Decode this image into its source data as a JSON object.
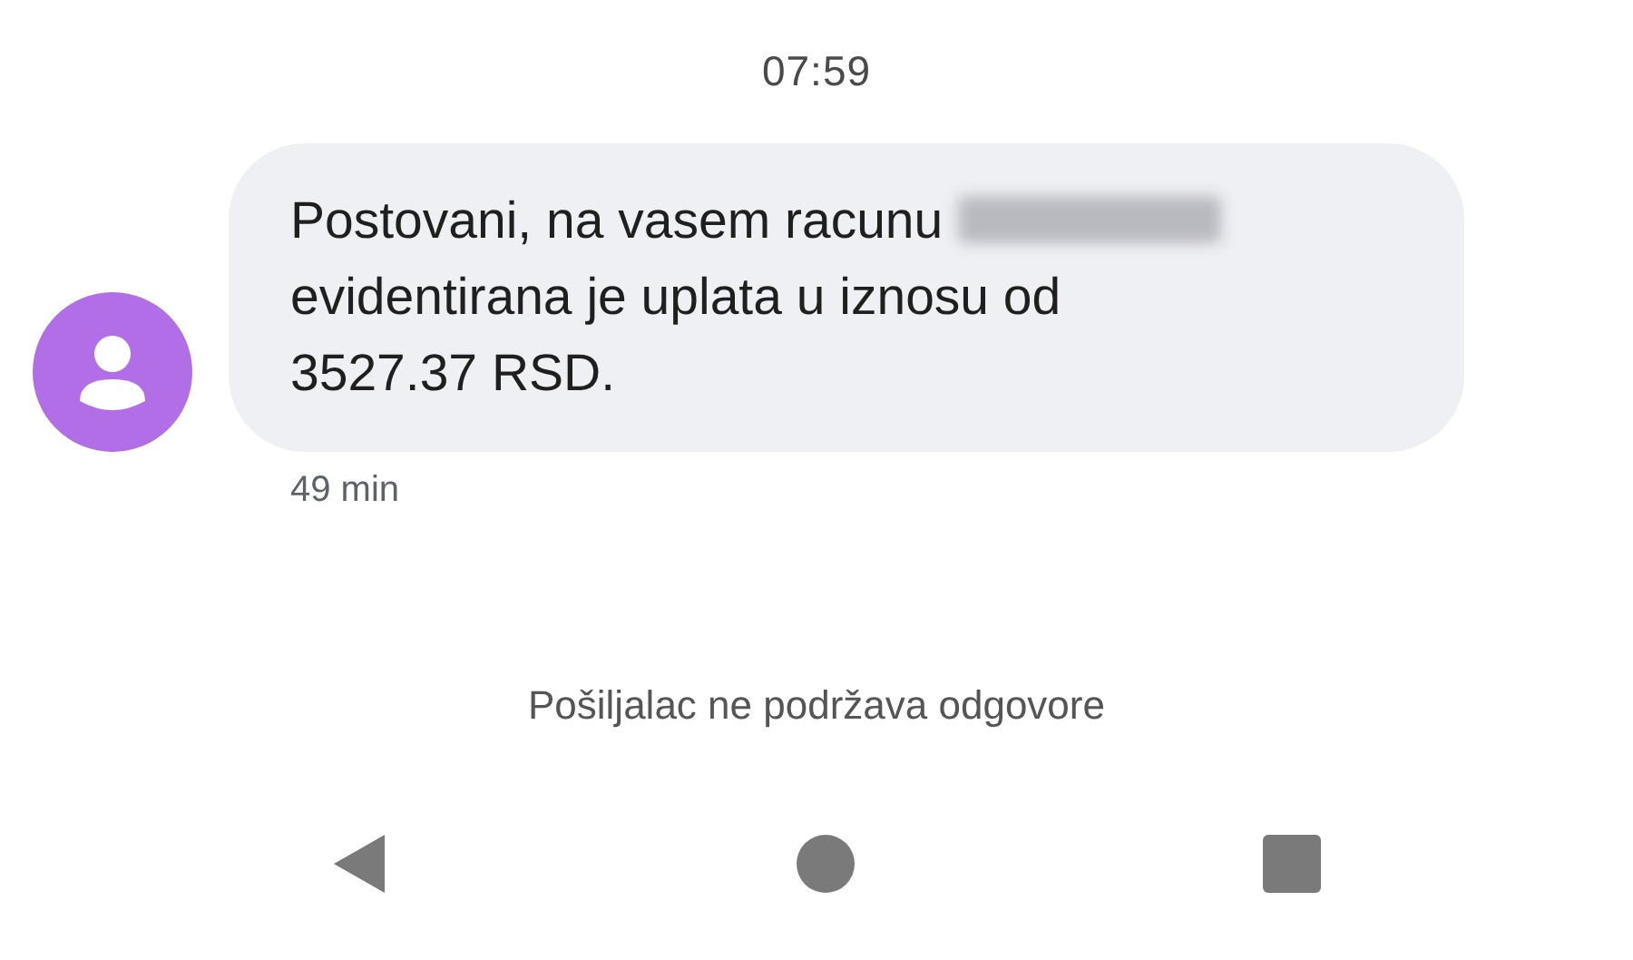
{
  "timestamp": "07:59",
  "message": {
    "text_before": "Postovani, na vasem racunu",
    "redacted": true,
    "text_after": "evidentirana je uplata u iznosu od 3527.37 RSD.",
    "time": "49 min"
  },
  "notice": "Pošiljalac ne podržava odgovore",
  "nav_bar": [
    {
      "kind": "back"
    },
    {
      "kind": "home"
    },
    {
      "kind": "recents"
    }
  ]
}
